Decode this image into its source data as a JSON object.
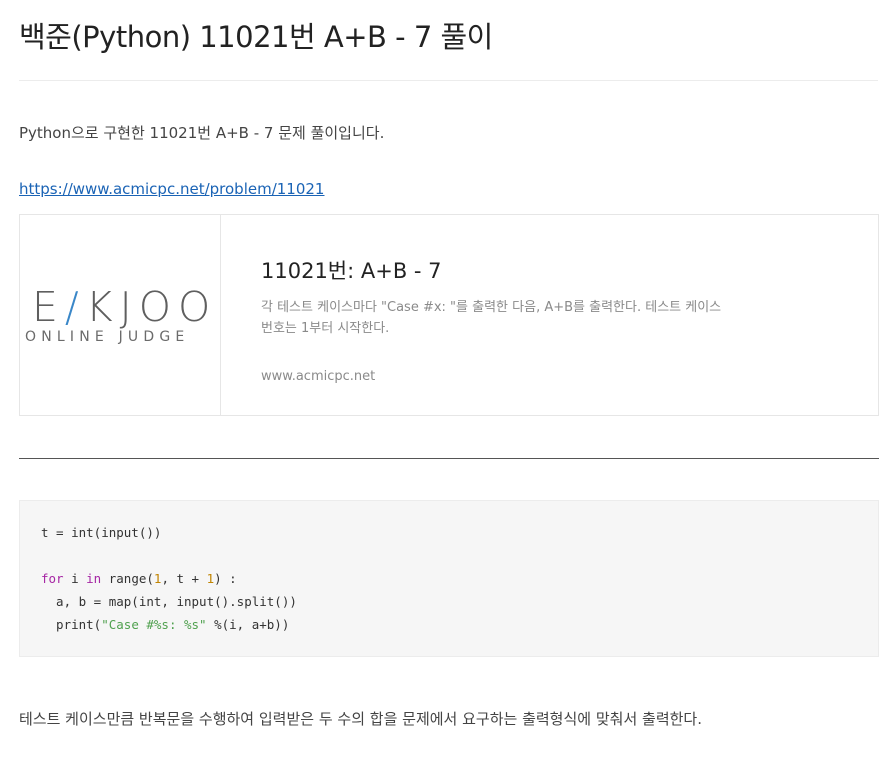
{
  "post": {
    "title": "백준(Python) 11021번 A+B - 7 풀이",
    "intro": "Python으로 구현한 11021번 A+B - 7 문제 풀이입니다.",
    "link_text": "https://www.acmicpc.net/problem/11021",
    "summary": "테스트 케이스만큼 반복문을 수행하여 입력받은 두 수의 합을 문제에서 요구하는 출력형식에 맞춰서 출력한다."
  },
  "og_card": {
    "logo_main": "E〈JOO",
    "logo_sub": "ONLINE JUDGE",
    "title": "11021번: A+B - 7",
    "description": "각 테스트 케이스마다 \"Case #x: \"를 출력한 다음, A+B를 출력한다. 테스트 케이스 번호는 1부터 시작한다.",
    "url": "www.acmicpc.net"
  },
  "code": {
    "line1": "t = int(input())",
    "line3_kw1": "for",
    "line3_a": " i ",
    "line3_kw2": "in",
    "line3_b": " range(",
    "line3_n1": "1",
    "line3_c": ", t + ",
    "line3_n2": "1",
    "line3_d": ") :",
    "line4": "  a, b = map(int, input().split())",
    "line5_a": "  print(",
    "line5_str": "\"Case #%s: %s\"",
    "line5_b": " %(i, a+b))"
  },
  "colors": {
    "keyword": "#a626a4",
    "number": "#c18401",
    "string": "#50a14f",
    "link": "#1a63b5"
  }
}
